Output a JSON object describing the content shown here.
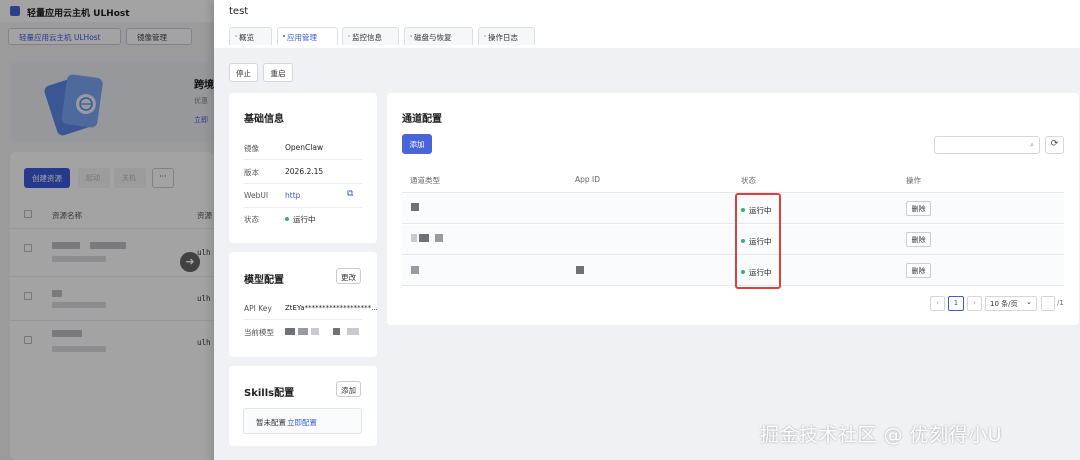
{
  "background": {
    "app_title": "轻量应用云主机 ULHost",
    "tabs": [
      "轻量应用云主机 ULHost",
      "镜像管理"
    ],
    "banner_title": "跨境",
    "banner_sub": "优惠",
    "banner_link": "立即",
    "toolbar": {
      "create": "创建资源",
      "ghost1": "起动",
      "ghost2": "关机",
      "more": "···"
    },
    "table_headers": [
      "资源名称",
      "资源"
    ],
    "rows": [
      {
        "note": "修改名称及备注",
        "code": "ulh"
      },
      {
        "note": "修改名称及备注",
        "code": "ulh"
      },
      {
        "note": "修改名称及备注",
        "code": "ulh"
      }
    ],
    "arrow": "➜"
  },
  "drawer": {
    "title": "test",
    "tabs": [
      "概览",
      "应用管理",
      "监控信息",
      "磁盘与恢复",
      "操作日志"
    ],
    "active_tab": "应用管理",
    "actions": {
      "stop": "停止",
      "restart": "重启"
    }
  },
  "basic_info": {
    "title": "基础信息",
    "rows": [
      {
        "label": "镜像",
        "value": "OpenClaw"
      },
      {
        "label": "版本",
        "value": "2026.2.15"
      },
      {
        "label": "WebUI",
        "value": "http"
      },
      {
        "label": "状态",
        "value": "运行中"
      }
    ],
    "copy_icon": "⧉"
  },
  "model_config": {
    "title": "模型配置",
    "edit_label": "更改",
    "api_key_label": "API Key",
    "api_key_value": "ZtEYa*******************...",
    "current_model_label": "当前模型"
  },
  "skills_config": {
    "title": "Skills配置",
    "add_label": "添加",
    "empty_text": "暂未配置",
    "configure_link": "立即配置"
  },
  "channel_config": {
    "title": "通道配置",
    "add_label": "添加",
    "search_placeholder": "",
    "search_icon": "⌕",
    "refresh_icon": "⟳",
    "columns": [
      "通道类型",
      "App ID",
      "状态",
      "操作"
    ],
    "rows": [
      {
        "status": "运行中",
        "action": "删除"
      },
      {
        "status": "运行中",
        "action": "删除"
      },
      {
        "status": "运行中",
        "action": "删除"
      }
    ],
    "pagination": {
      "prev": "‹",
      "page": "1",
      "next": "›",
      "page_size": "10 条/页",
      "page_size_arrow": "⌄",
      "total": "/1"
    }
  },
  "watermark": "掘金技术社区 @ 优刻得小U",
  "colors": {
    "accent": "#4a65d8",
    "status_green": "#35b26a",
    "highlight_red": "#d9423a"
  }
}
